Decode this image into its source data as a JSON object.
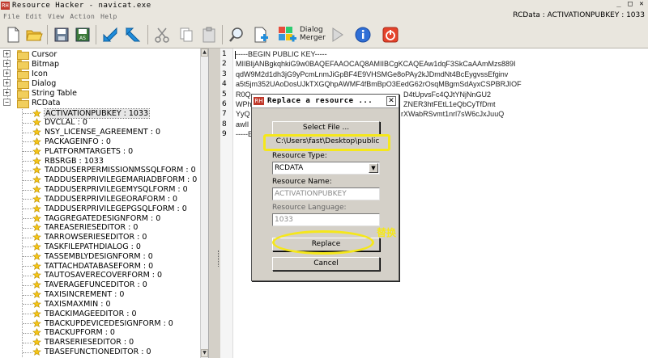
{
  "window": {
    "title": "Resource Hacker - navicat.exe",
    "app_icon": "RH",
    "controls": [
      "_",
      "□",
      "✕"
    ]
  },
  "menubar": {
    "items": [
      "File",
      "Edit",
      "View",
      "Action",
      "Help"
    ],
    "resource_path": "RCData : ACTIVATIONPUBKEY : 1033"
  },
  "toolbar": {
    "buttons": [
      "new-icon",
      "open-icon",
      "save-icon",
      "save-as-icon",
      "import-icon",
      "export-icon",
      "cut-icon",
      "copy-icon",
      "paste-icon",
      "find-icon",
      "add-resource-icon",
      "add-image-icon",
      "dialog-merger-icon",
      "run-script-icon",
      "info-icon",
      "power-icon"
    ],
    "dialog_merger_label": "Dialog\nMerger"
  },
  "tree": {
    "top_nodes": [
      "Cursor",
      "Bitmap",
      "Icon",
      "Dialog",
      "String Table",
      "RCData"
    ],
    "rcdata_items": [
      "ACTIVATIONPUBKEY : 1033",
      "DVCLAL : 0",
      "NSY_LICENSE_AGREEMENT : 0",
      "PACKAGEINFO : 0",
      "PLATFORMTARGETS : 0",
      "RBSRGB : 1033",
      "TADDUSERPERMISSIONMSSQLFORM : 0",
      "TADDUSERPRIVILEGEMARIADBFORM : 0",
      "TADDUSERPRIVILEGEMYSQLFORM : 0",
      "TADDUSERPRIVILEGEORAFORM : 0",
      "TADDUSERPRIVILEGEPGSQLFORM : 0",
      "TAGGREGATEDESIGNFORM : 0",
      "TAREASERIESEDITOR : 0",
      "TARROWSERIESEDITOR : 0",
      "TASKFILEPATHDIALOG : 0",
      "TASSEMBLYDESIGNFORM : 0",
      "TATTACHDATABASEFORM : 0",
      "TAUTOSAVERECOVERFORM : 0",
      "TAVERAGEFUNCEDITOR : 0",
      "TAXISINCREMENT : 0",
      "TAXISMAXMIN : 0",
      "TBACKIMAGEEDITOR : 0",
      "TBACKUPDEVICEDESIGNFORM : 0",
      "TBACKUPFORM : 0",
      "TBARSERIESEDITOR : 0",
      "TBASEFUNCTIONEDITOR : 0"
    ]
  },
  "editor": {
    "line_numbers": [
      "1",
      "2",
      "3",
      "4",
      "5",
      "6",
      "7",
      "8",
      "9"
    ],
    "lines": [
      "-----BEGIN PUBLIC KEY-----",
      "MIIBIjANBgkqhkiG9w0BAQEFAAOCAQ8AMIIBCgKCAQEAw1dqF3SkCaAAmMzs889I",
      "qdW9M2d1dh3jG9yPcmLnmJiGpBF4E9VHSMGe8oPAy2kJDmdNt4BcEygvssEfginv",
      "a5t5jm352UAoDosUJkTXGQhpAWMF4fBmBpO3EedG62rOsqMBgmSdAyxCSPBRJIOF",
      "R0Q",
      "WPh",
      "YyQ",
      "awIl",
      "-----E"
    ],
    "line_tails": {
      "5": "D4tUpvsFc4QJtYNjNnGU2",
      "6": "ZNER3htFEtL1eQbCyTfDmt",
      "7": "rXWabRSvmt1nrl7sW6cJxJuuQ"
    }
  },
  "dialog": {
    "title": "Replace a resource ...",
    "icon": "RH",
    "close": "✕",
    "select_file_label": "Select File ...",
    "file_path": "C:\\Users\\fast\\Desktop\\public",
    "resource_type_label": "Resource Type:",
    "resource_type_value": "RCDATA",
    "resource_name_label": "Resource Name:",
    "resource_name_value": "ACTIVATIONPUBKEY",
    "resource_language_label": "Resource Language:",
    "resource_language_value": "1033",
    "replace_label": "Replace",
    "cancel_label": "Cancel"
  },
  "annotation": {
    "text": "替换",
    "color": "#f5e71b"
  }
}
